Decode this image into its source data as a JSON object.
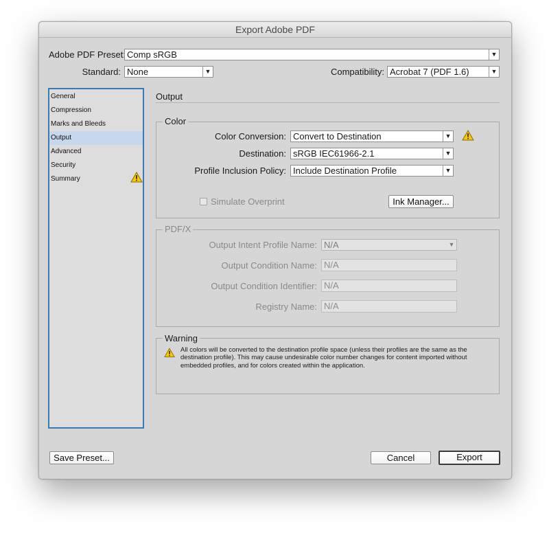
{
  "window": {
    "title": "Export Adobe PDF"
  },
  "preset": {
    "label": "Adobe PDF Preset:",
    "value": "Comp sRGB"
  },
  "standard": {
    "label": "Standard:",
    "value": "None"
  },
  "compatibility": {
    "label": "Compatibility:",
    "value": "Acrobat 7 (PDF 1.6)"
  },
  "sidebar": {
    "items": [
      {
        "label": "General"
      },
      {
        "label": "Compression"
      },
      {
        "label": "Marks and Bleeds"
      },
      {
        "label": "Output",
        "selected": true
      },
      {
        "label": "Advanced"
      },
      {
        "label": "Security"
      },
      {
        "label": "Summary",
        "icon": "warning-icon"
      }
    ]
  },
  "section": {
    "title": "Output"
  },
  "color": {
    "legend": "Color",
    "color_conversion": {
      "label": "Color Conversion:",
      "value": "Convert to Destination"
    },
    "destination": {
      "label": "Destination:",
      "value": "sRGB IEC61966-2.1"
    },
    "profile_policy": {
      "label": "Profile Inclusion Policy:",
      "value": "Include Destination Profile"
    },
    "simulate_overprint": {
      "label": "Simulate Overprint",
      "checked": false
    },
    "ink_manager": "Ink Manager..."
  },
  "pdfx": {
    "legend": "PDF/X",
    "output_intent": {
      "label": "Output Intent Profile Name:",
      "value": "N/A"
    },
    "condition_name": {
      "label": "Output Condition Name:",
      "value": "N/A"
    },
    "condition_identifier": {
      "label": "Output Condition Identifier:",
      "value": "N/A"
    },
    "registry_name": {
      "label": "Registry Name:",
      "value": "N/A"
    }
  },
  "warning": {
    "legend": "Warning",
    "text": "All colors will be converted to the destination profile space (unless their profiles are the same as the destination profile). This may cause undesirable color number changes for content imported without embedded profiles, and for colors created within the application."
  },
  "buttons": {
    "save_preset": "Save Preset...",
    "cancel": "Cancel",
    "export": "Export"
  },
  "colors": {
    "selection": "#c7d7ee",
    "sidebar_border": "#3d78b3",
    "warning": "#f5c518"
  }
}
